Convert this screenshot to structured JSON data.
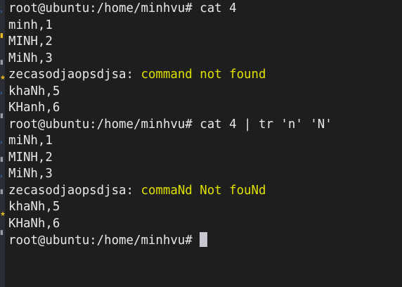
{
  "terminal": {
    "prompt": "root@ubuntu:/home/minhvu#",
    "line1": {
      "command": " cat 4"
    },
    "line2": {
      "text": "minh,1"
    },
    "line3": {
      "text": "MINH,2"
    },
    "line4": {
      "text": "MiNh,3"
    },
    "line5": {
      "prefix": "zecasodjaopsdjsa: ",
      "error": "command not found"
    },
    "line6": {
      "text": "khaNh,5"
    },
    "line7": {
      "text": "KHanh,6"
    },
    "line8": {
      "command": " cat 4 | tr 'n' 'N'"
    },
    "line9": {
      "text": "miNh,1"
    },
    "line10": {
      "text": "MINH,2"
    },
    "line11": {
      "text": "MiNh,3"
    },
    "line12": {
      "prefix": "zecasodjaopsdjsa: ",
      "error": "commaNd Not fouNd"
    },
    "line13": {
      "text": "khaNh,5"
    },
    "line14": {
      "text": "KHaNh,6"
    },
    "line15": {
      "command": " "
    }
  },
  "colors": {
    "background": "#1e1e1e",
    "foreground": "#e8e8e8",
    "error_text": "#e0e000",
    "cursor": "#c8c8d0"
  },
  "sidebar_icons": [
    "chevron-right-icon",
    "folder-icon",
    "star-icon",
    "chevron-right-icon",
    "folder-icon",
    "chevron-right-icon",
    "folder-icon",
    "folder-icon",
    "chevron-right-icon",
    "chevron-right-icon",
    "star-icon",
    "folder-icon"
  ]
}
